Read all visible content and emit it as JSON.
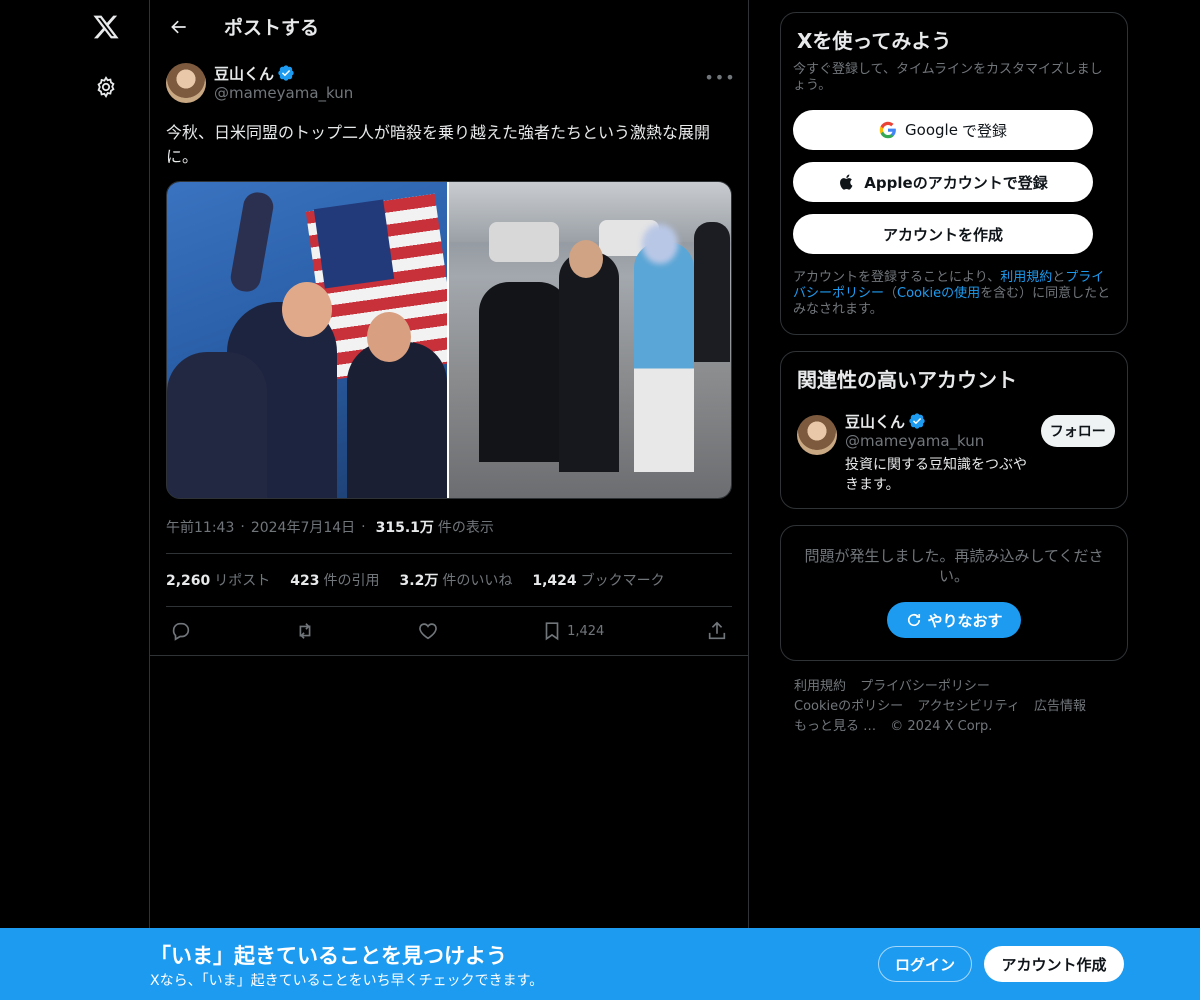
{
  "header": {
    "title": "ポストする"
  },
  "tweet": {
    "author_name": "豆山くん",
    "author_handle": "@mameyama_kun",
    "text": "今秋、日米同盟のトップ二人が暗殺を乗り越えた強者たちという激熱な展開に。",
    "time": "午前11:43",
    "date": "2024年7月14日",
    "views_count": "315.1万",
    "views_label": "件の表示",
    "stats": {
      "reposts_count": "2,260",
      "reposts_label": "リポスト",
      "quotes_count": "423",
      "quotes_label": "件の引用",
      "likes_count": "3.2万",
      "likes_label": "件のいいね",
      "bookmarks_count": "1,424",
      "bookmarks_label": "ブックマーク"
    },
    "bookmark_action_count": "1,424"
  },
  "signup_card": {
    "title": "Xを使ってみよう",
    "subtitle": "今すぐ登録して、タイムラインをカスタマイズしましょう。",
    "google_brand": "Google",
    "google_suffix": "で登録",
    "apple_label": "Appleのアカウントで登録",
    "create_label": "アカウントを作成",
    "legal_prefix": "アカウントを登録することにより、",
    "legal_terms": "利用規約",
    "legal_and": "と",
    "legal_privacy": "プライバシーポリシー",
    "legal_paren_open": "（",
    "legal_cookie": "Cookieの使用",
    "legal_suffix": "を含む）に同意したとみなされます。"
  },
  "related_card": {
    "title": "関連性の高いアカウント",
    "name": "豆山くん",
    "handle": "@mameyama_kun",
    "follow_label": "フォロー",
    "bio": "投資に関する豆知識をつぶやきます。"
  },
  "error_card": {
    "text": "問題が発生しました。再読み込みしてください。",
    "retry_label": "やりなおす"
  },
  "footer": {
    "terms": "利用規約",
    "privacy": "プライバシーポリシー",
    "cookie": "Cookieのポリシー",
    "accessibility": "アクセシビリティ",
    "ads": "広告情報",
    "more": "もっと見る …",
    "copyright": "© 2024 X Corp."
  },
  "bottom_bar": {
    "title": "「いま」起きていることを見つけよう",
    "subtitle": "Xなら、「いま」起きていることをいち早くチェックできます。",
    "login_label": "ログイン",
    "signup_label": "アカウント作成"
  },
  "colors": {
    "accent": "#1d9bf0",
    "background": "#000000",
    "border": "#2f3336",
    "muted": "#71767b"
  }
}
